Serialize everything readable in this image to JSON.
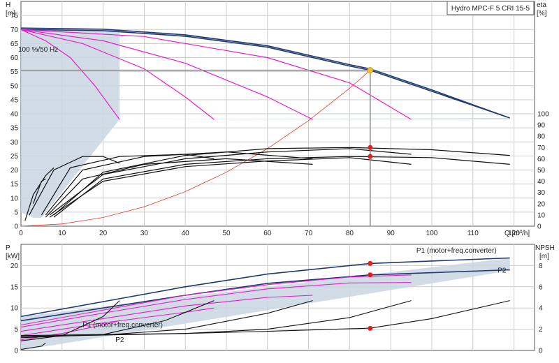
{
  "chart_data": [
    {
      "type": "line",
      "title": "Hydro MPC-F 5 CRI 15-5",
      "ylabel": "H",
      "yunit": "[m]",
      "y2label": "eta",
      "y2unit": "[%]",
      "xlabel": "Q [m³/h]",
      "xlim": [
        0,
        125
      ],
      "ylim": [
        0,
        80
      ],
      "y2lim": [
        0,
        100
      ],
      "xticks": [
        0,
        10,
        20,
        30,
        40,
        50,
        60,
        70,
        80,
        90,
        100,
        110,
        120
      ],
      "yticks": [
        0,
        5,
        10,
        15,
        20,
        25,
        30,
        35,
        40,
        45,
        50,
        55,
        60,
        65,
        70,
        75
      ],
      "y2ticks": [
        0,
        10,
        20,
        30,
        40,
        50,
        60,
        70,
        80,
        90,
        100
      ],
      "grid": true,
      "annotation": "100 %/50 Hz",
      "duty_point": {
        "x": 85,
        "y": 55.5
      },
      "eta_points": [
        {
          "x": 85,
          "y": 70
        },
        {
          "x": 85,
          "y": 62
        }
      ],
      "area_band": {
        "x": [
          0,
          24,
          24,
          119,
          119,
          24,
          5,
          3,
          0
        ],
        "y": [
          70,
          70,
          38,
          38,
          38.5,
          38,
          3,
          3,
          5
        ]
      },
      "series": [
        {
          "role": "head",
          "pumps": 5,
          "color": "#1f3a70",
          "x": [
            0,
            20,
            40,
            60,
            80,
            85,
            100,
            119
          ],
          "y": [
            70,
            69.6,
            67.6,
            63.7,
            57.0,
            55.5,
            48.0,
            38.5
          ]
        },
        {
          "role": "head",
          "pumps": 5,
          "color": "#1f3a70",
          "x": [
            0,
            20,
            40,
            60,
            80,
            85,
            100,
            118
          ],
          "y": [
            70.5,
            70.1,
            68.1,
            64.2,
            57.5,
            56.0,
            48.5,
            39.0
          ]
        },
        {
          "role": "head_reduced",
          "color": "#e61ec8",
          "x": [
            0,
            30,
            60,
            80,
            95
          ],
          "y": [
            70,
            67.5,
            60,
            51,
            38
          ]
        },
        {
          "role": "head_reduced",
          "color": "#e61ec8",
          "x": [
            0,
            20,
            40,
            60,
            71
          ],
          "y": [
            70,
            66,
            58,
            46,
            38
          ]
        },
        {
          "role": "head_reduced",
          "color": "#e61ec8",
          "x": [
            0,
            15,
            30,
            40,
            47
          ],
          "y": [
            70,
            65,
            56,
            46,
            38
          ]
        },
        {
          "role": "head_reduced",
          "color": "#e61ec8",
          "x": [
            0,
            6,
            12,
            18,
            24
          ],
          "y": [
            70,
            66,
            60,
            50,
            38
          ]
        },
        {
          "role": "system_curve",
          "color": "#e03a2a",
          "x": [
            0,
            10,
            20,
            30,
            40,
            50,
            60,
            70,
            80,
            85
          ],
          "y": [
            0,
            0.8,
            3.1,
            6.9,
            12.3,
            19.2,
            27.6,
            37.6,
            49.1,
            55.5
          ]
        },
        {
          "role": "efficiency",
          "color": "#111111",
          "x": [
            8,
            20,
            40,
            60,
            80,
            100,
            119
          ],
          "y": [
            10,
            48,
            63,
            69,
            70,
            68,
            63
          ]
        },
        {
          "role": "efficiency",
          "color": "#111111",
          "x": [
            7,
            20,
            40,
            60,
            80,
            95
          ],
          "y": [
            10,
            46,
            60,
            66,
            69,
            64
          ]
        },
        {
          "role": "efficiency",
          "color": "#111111",
          "x": [
            6,
            15,
            30,
            50,
            71
          ],
          "y": [
            10,
            50,
            62,
            66,
            60
          ]
        },
        {
          "role": "efficiency",
          "color": "#111111",
          "x": [
            5,
            12,
            24,
            40,
            47
          ],
          "y": [
            10,
            52,
            62,
            64,
            60
          ]
        },
        {
          "role": "efficiency",
          "color": "#111111",
          "x": [
            2,
            8,
            15,
            20,
            24
          ],
          "y": [
            10,
            50,
            62,
            62,
            56
          ]
        },
        {
          "role": "efficiency_lower",
          "color": "#111111",
          "x": [
            8,
            20,
            40,
            60,
            80,
            100,
            119
          ],
          "y": [
            8,
            42,
            55,
            60,
            62,
            61,
            55
          ]
        },
        {
          "role": "efficiency_lower",
          "color": "#111111",
          "x": [
            7,
            20,
            40,
            60,
            80,
            95
          ],
          "y": [
            8,
            40,
            53,
            58,
            61,
            55
          ]
        },
        {
          "role": "efficiency_lower",
          "color": "#111111",
          "x": [
            6,
            15,
            30,
            50,
            71
          ],
          "y": [
            8,
            42,
            55,
            60,
            55
          ]
        },
        {
          "role": "efficiency_lower",
          "color": "#111111",
          "x": [
            1,
            3,
            6,
            8
          ],
          "y": [
            5,
            28,
            45,
            52
          ]
        },
        {
          "role": "efficiency_lower",
          "color": "#111111",
          "x": [
            3,
            5,
            6
          ],
          "y": [
            20,
            40,
            42
          ]
        }
      ]
    },
    {
      "type": "line",
      "ylabel": "P",
      "yunit": "[kW]",
      "y2label": "NPSH",
      "y2unit": "[m]",
      "xlim": [
        0,
        125
      ],
      "ylim": [
        0,
        25
      ],
      "y2lim": [
        0,
        10
      ],
      "yticks": [
        0,
        5,
        10,
        15,
        20
      ],
      "y2ticks": [
        0,
        2,
        4,
        6,
        8
      ],
      "grid": true,
      "labels": [
        {
          "text": "P1 (motor+freq.converter)",
          "x": 106,
          "y": 23.0
        },
        {
          "text": "P2",
          "x": 116,
          "y": 18.3
        },
        {
          "text": "P1 (motor+freq.converter)",
          "x": 15,
          "y": 5.5
        },
        {
          "text": "P2",
          "x": 23,
          "y": 2.0
        }
      ],
      "duty_points": [
        {
          "x": 85,
          "y": 20.5
        },
        {
          "x": 85,
          "y": 17.8
        },
        {
          "x": 85,
          "y": 5.2
        }
      ],
      "area_band": {
        "x": [
          0,
          119,
          119,
          0
        ],
        "y": [
          8,
          21.8,
          18.8,
          0
        ]
      },
      "series": [
        {
          "role": "P1",
          "color": "#1f3a70",
          "x": [
            0,
            20,
            40,
            60,
            85,
            119
          ],
          "y": [
            8,
            11.5,
            15,
            18,
            20.5,
            21.8
          ]
        },
        {
          "role": "P2",
          "color": "#1f3a70",
          "x": [
            0,
            20,
            40,
            60,
            85,
            119
          ],
          "y": [
            7,
            10,
            13,
            15.8,
            17.8,
            19
          ]
        },
        {
          "role": "P_reduced",
          "color": "#e61ec8",
          "x": [
            0,
            20,
            40,
            60,
            80,
            95
          ],
          "y": [
            6,
            9.5,
            13,
            15.5,
            17.3,
            17.8
          ]
        },
        {
          "role": "P_reduced",
          "color": "#e61ec8",
          "x": [
            0,
            20,
            40,
            60,
            80,
            95
          ],
          "y": [
            5.5,
            8.8,
            12,
            14.5,
            15.9,
            16
          ]
        },
        {
          "role": "P_reduced",
          "color": "#e61ec8",
          "x": [
            0,
            20,
            40,
            60,
            71
          ],
          "y": [
            4.5,
            7.5,
            10.5,
            12.5,
            13
          ]
        },
        {
          "role": "P_reduced",
          "color": "#e61ec8",
          "x": [
            0,
            20,
            40,
            47
          ],
          "y": [
            3.5,
            6.5,
            9,
            10
          ]
        },
        {
          "role": "P_reduced",
          "color": "#e61ec8",
          "x": [
            0,
            10,
            20,
            24
          ],
          "y": [
            2.5,
            4,
            6,
            7
          ]
        },
        {
          "role": "NPSH",
          "color": "#111111",
          "x": [
            0,
            20,
            40,
            60,
            85,
            100,
            119
          ],
          "y": [
            1.4,
            1.5,
            1.6,
            1.8,
            2.1,
            3.0,
            4.7
          ]
        },
        {
          "role": "NPSH",
          "color": "#111111",
          "x": [
            0,
            20,
            40,
            60,
            80,
            95
          ],
          "y": [
            1.3,
            1.45,
            1.6,
            2.0,
            3.1,
            4.7
          ]
        },
        {
          "role": "NPSH",
          "color": "#111111",
          "x": [
            0,
            20,
            40,
            60,
            71
          ],
          "y": [
            1.3,
            1.45,
            2.0,
            3.5,
            4.7
          ]
        },
        {
          "role": "NPSH",
          "color": "#111111",
          "x": [
            0,
            20,
            35,
            47
          ],
          "y": [
            1.2,
            1.5,
            2.8,
            4.7
          ]
        },
        {
          "role": "NPSH",
          "color": "#111111",
          "x": [
            0,
            10,
            20,
            24
          ],
          "y": [
            0.9,
            1.4,
            3.2,
            4.7
          ]
        },
        {
          "role": "NPSH",
          "color": "#111111",
          "x": [
            0,
            5,
            6
          ],
          "y": [
            0.1,
            0.4,
            0.7
          ]
        }
      ]
    }
  ]
}
